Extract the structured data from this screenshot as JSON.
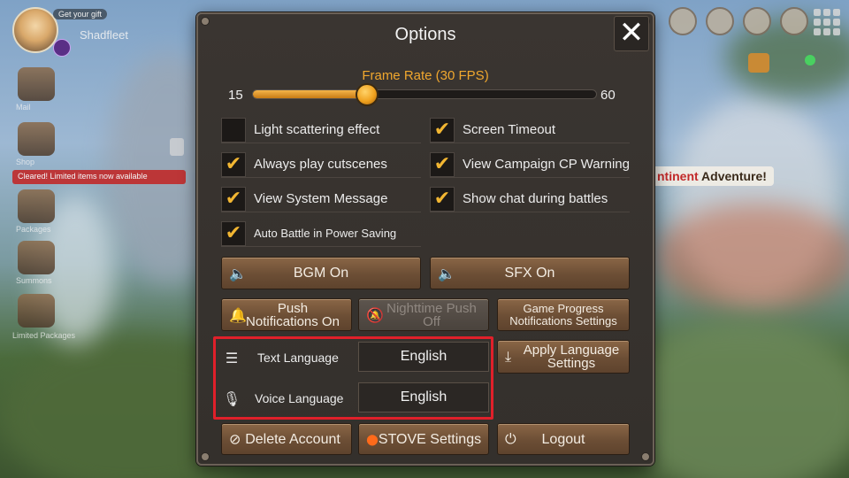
{
  "hud": {
    "chip_text": "Get your gift",
    "player_name": "Shadfleet",
    "red_banner": "Cleared! Limited items now available",
    "labels": [
      "Mail",
      "Shop",
      "Packages",
      "Summons",
      "Limited Packages"
    ],
    "adventure_prefix": "ntinent",
    "adventure_suffix": "Adventure!"
  },
  "dialog": {
    "title": "Options",
    "close_symbol": "✕",
    "frame_rate": {
      "label": "Frame Rate (30 FPS)",
      "min_label": "15",
      "max_label": "60",
      "value": 30,
      "min": 15,
      "max": 60
    },
    "checkboxes": [
      {
        "label": "Light scattering effect",
        "checked": false
      },
      {
        "label": "Screen Timeout",
        "checked": true
      },
      {
        "label": "Always play cutscenes",
        "checked": true
      },
      {
        "label": "View Campaign CP Warning",
        "checked": true
      },
      {
        "label": "View System Message",
        "checked": true
      },
      {
        "label": "Show chat during battles",
        "checked": true
      },
      {
        "label": "Auto Battle in Power Saving",
        "checked": true
      }
    ],
    "check_glyph": "✔",
    "buttons": {
      "bgm": "BGM On",
      "sfx": "SFX On",
      "push_line1": "Push",
      "push_line2": "Notifications On",
      "night_line1": "Nighttime Push",
      "night_line2": "Off",
      "progress_line1": "Game Progress",
      "progress_line2": "Notifications Settings",
      "apply_line1": "Apply Language",
      "apply_line2": "Settings",
      "delete": "Delete Account",
      "stove": "STOVE Settings",
      "logout": "Logout"
    },
    "language": {
      "text_label": "Text Language",
      "text_value": "English",
      "voice_label": "Voice Language",
      "voice_value": "English"
    },
    "icons": {
      "speaker": "🔈",
      "bell": "🔔",
      "bell_off": "🔕",
      "download": "⤓",
      "text_lang": "☰",
      "mic": "🎙",
      "person_off": "⊘",
      "flame": "●",
      "power": "⏻"
    },
    "colors": {
      "accent": "#f0a72e",
      "highlight": "#e0202a"
    }
  }
}
